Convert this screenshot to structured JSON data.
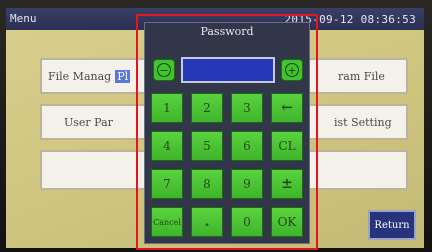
{
  "titlebar": {
    "menu": "Menu",
    "clock": "2015-09-12 08:36:53"
  },
  "background": {
    "file_manage": "File Manag",
    "file_manage_tail": "Pl",
    "user_param": "User Par",
    "program_file": "ram File",
    "list_setting": "ist Setting",
    "return": "Return"
  },
  "dialog": {
    "title": "Password",
    "minus_symbol": "−",
    "plus_symbol": "+",
    "password_value": "",
    "keys": [
      "1",
      "2",
      "3",
      "←",
      "4",
      "5",
      "6",
      "CL",
      "7",
      "8",
      "9",
      "±",
      "Cancel",
      ".",
      "0",
      "OK"
    ]
  },
  "colors": {
    "accent_green": "#41c52e",
    "dialog_bg": "#323649",
    "field_blue": "#2438b8",
    "highlight_red": "#e2161c",
    "screen_bg": "#d8cf8e"
  }
}
